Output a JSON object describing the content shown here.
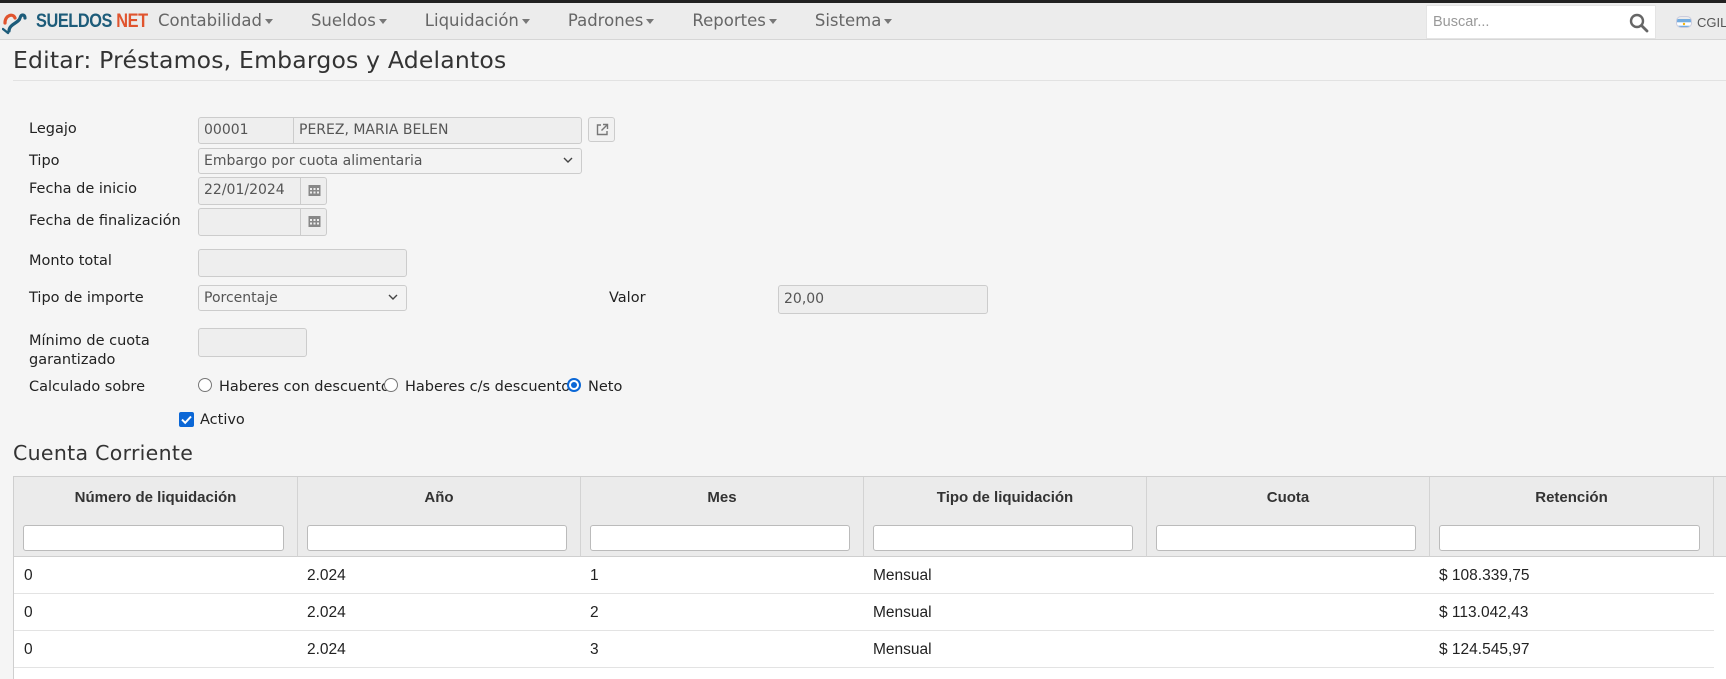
{
  "brand": {
    "part1": "SUELDOS",
    "part2": "NET",
    "logo_icon": "sueldos-net-logo"
  },
  "nav": {
    "items": [
      {
        "label": "Contabilidad"
      },
      {
        "label": "Sueldos"
      },
      {
        "label": "Liquidación"
      },
      {
        "label": "Padrones"
      },
      {
        "label": "Reportes"
      },
      {
        "label": "Sistema"
      }
    ],
    "search_placeholder": "Buscar...",
    "user_label": "CGIL",
    "flag_icon": "argentina-flag-icon"
  },
  "page": {
    "title": "Editar: Préstamos, Embargos y Adelantos"
  },
  "form": {
    "legajo": {
      "label": "Legajo",
      "code": "00001",
      "name": "PEREZ, MARIA BELEN"
    },
    "tipo": {
      "label": "Tipo",
      "value": "Embargo por cuota alimentaria"
    },
    "fecha_inicio": {
      "label": "Fecha de inicio",
      "value": "22/01/2024"
    },
    "fecha_fin": {
      "label": "Fecha de finalización",
      "value": ""
    },
    "monto_total": {
      "label": "Monto total",
      "value": ""
    },
    "tipo_importe": {
      "label": "Tipo de importe",
      "value": "Porcentaje"
    },
    "valor": {
      "label": "Valor",
      "value": "20,00"
    },
    "minimo_cuota": {
      "label_line1": "Mínimo de cuota",
      "label_line2": "garantizado",
      "value": ""
    },
    "calculado_sobre": {
      "label": "Calculado sobre",
      "options": [
        "Haberes con descuento",
        "Haberes c/s descuento",
        "Neto"
      ],
      "selected": "Neto"
    },
    "activo": {
      "label": "Activo",
      "checked": true
    }
  },
  "cuenta_corriente": {
    "title": "Cuenta Corriente",
    "columns": [
      "Número de liquidación",
      "Año",
      "Mes",
      "Tipo de liquidación",
      "Cuota",
      "Retención"
    ],
    "rows": [
      [
        "0",
        "2.024",
        "1",
        "Mensual",
        "",
        "$ 108.339,75"
      ],
      [
        "0",
        "2.024",
        "2",
        "Mensual",
        "",
        "$ 113.042,43"
      ],
      [
        "0",
        "2.024",
        "3",
        "Mensual",
        "",
        "$ 124.545,97"
      ]
    ]
  },
  "colors": {
    "accent": "#0b67d6",
    "brand_dark": "#1d5c7a",
    "brand_orange": "#e0542e"
  }
}
